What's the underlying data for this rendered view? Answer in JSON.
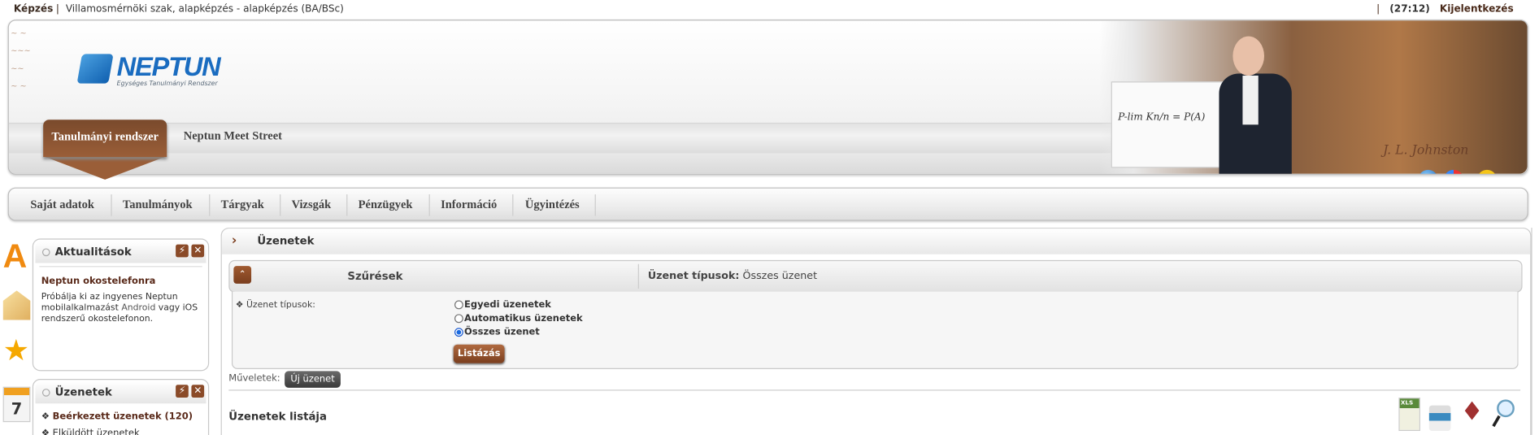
{
  "topbar": {
    "program_label": "Képzés",
    "separator": "|",
    "program_value": "Villamosmérnöki szak, alapképzés - alapképzés (BA/BSc)",
    "right_separator": "|",
    "session_timer": "(27:12)",
    "logout": "Kijelentkezés"
  },
  "header": {
    "logo_name": "NEPTUN",
    "logo_subtitle": "Egységes Tanulmányi Rendszer",
    "tabs": [
      {
        "label": "Tanulmányi rendszer",
        "active": true
      },
      {
        "label": "Neptun Meet Street",
        "active": false
      }
    ],
    "board_formula": "P-lim Kn/n = P(A)",
    "signature": "J. L. Johnston",
    "icons": [
      "globe-icon",
      "color-theme-icon",
      "accessibility-icon"
    ]
  },
  "nav": {
    "items": [
      {
        "label": "Saját adatok"
      },
      {
        "label": "Tanulmányok"
      },
      {
        "label": "Tárgyak"
      },
      {
        "label": "Vizsgák"
      },
      {
        "label": "Pénzügyek"
      },
      {
        "label": "Információ"
      },
      {
        "label": "Ügyintézés"
      }
    ]
  },
  "sidebar": {
    "quick_icons": [
      "letter-a-icon",
      "envelope-icon",
      "star-icon",
      "calendar-icon"
    ],
    "news": {
      "title": "Aktualitások",
      "item_title": "Neptun okostelefonra",
      "body_1": "Próbálja ki az ingyenes Neptun mobilalkalmazást ",
      "body_link": "Android",
      "body_2": " vagy iOS rendszerű okostelefonon."
    },
    "messages": {
      "title": "Üzenetek",
      "items": [
        {
          "label": "Beérkezett üzenetek (120)"
        },
        {
          "label": "Elküldött üzenetek"
        }
      ]
    }
  },
  "main": {
    "title": "Üzenetek",
    "filter": {
      "title": "Szűrések",
      "summary_label": "Üzenet típusok:",
      "summary_value": " Összes üzenet",
      "field_label": "Üzenet típusok:",
      "options": [
        {
          "label": "Egyedi üzenetek",
          "checked": false
        },
        {
          "label": "Automatikus üzenetek",
          "checked": false
        },
        {
          "label": "Összes üzenet",
          "checked": true
        }
      ],
      "submit": "Listázás"
    },
    "operations_label": "Műveletek:",
    "new_message": "Új üzenet",
    "list_title": "Üzenetek listája",
    "toolbar_icons": [
      "xls-export-icon",
      "print-icon",
      "pin-icon",
      "search-icon"
    ],
    "xls_text": "XLS"
  }
}
